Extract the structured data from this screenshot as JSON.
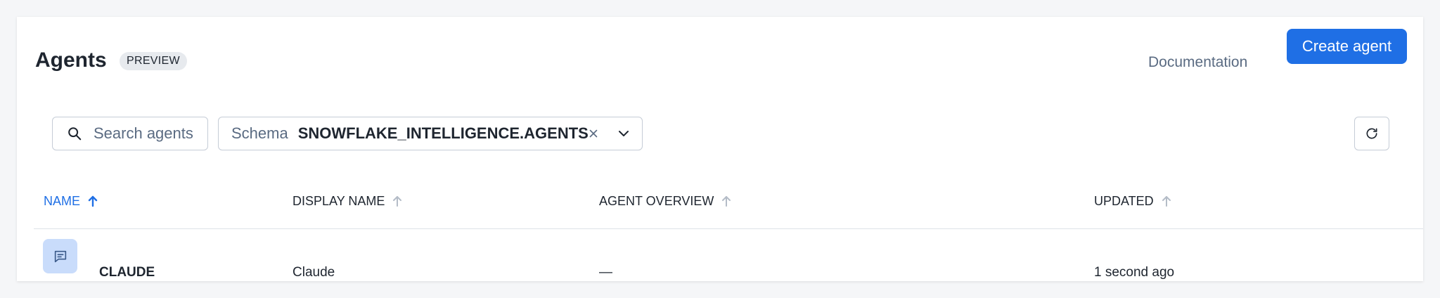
{
  "header": {
    "title": "Agents",
    "badge": "PREVIEW",
    "documentation_link": "Documentation",
    "create_button": "Create agent"
  },
  "filters": {
    "search_placeholder": "Search agents",
    "schema_label": "Schema",
    "schema_value": "SNOWFLAKE_INTELLIGENCE.AGENTS"
  },
  "table": {
    "columns": [
      {
        "label": "NAME",
        "sort": "ascending",
        "active": true
      },
      {
        "label": "DISPLAY NAME",
        "sort": "none",
        "active": false
      },
      {
        "label": "AGENT OVERVIEW",
        "sort": "none",
        "active": false
      },
      {
        "label": "UPDATED",
        "sort": "none",
        "active": false
      }
    ],
    "rows": [
      {
        "icon": "chat-icon",
        "name": "CLAUDE",
        "display_name": "Claude",
        "overview": "—",
        "updated": "1 second ago"
      }
    ]
  },
  "colors": {
    "accent": "#1f6fe5",
    "row_icon_bg": "#c9dcfb",
    "badge_bg": "#e7eaee",
    "muted_text": "#5a6b82"
  },
  "icons": [
    "search-icon",
    "close-icon",
    "chevron-down-icon",
    "refresh-icon",
    "sort-arrow-icon",
    "chat-icon"
  ]
}
